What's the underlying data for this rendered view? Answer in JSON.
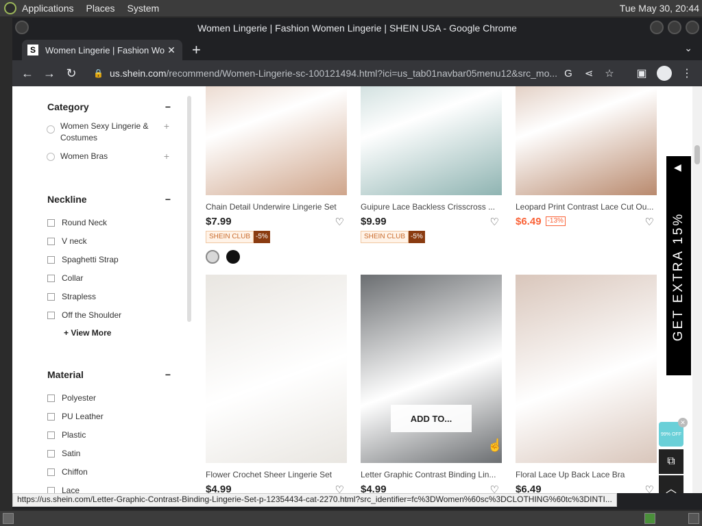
{
  "os": {
    "menus": [
      "Applications",
      "Places",
      "System"
    ],
    "clock": "Tue May 30, 20:44"
  },
  "browser": {
    "window_title": "Women Lingerie | Fashion Women Lingerie | SHEIN USA - Google Chrome",
    "tab": {
      "favicon": "S",
      "title": "Women Lingerie | Fashion Wo",
      "close": "✕"
    },
    "new_tab": "+",
    "url_host": "us.shein.com",
    "url_path": "/recommend/Women-Lingerie-sc-100121494.html?ici=us_tab01navbar05menu12&src_mo..."
  },
  "sidebar": {
    "groups": [
      {
        "title": "Category",
        "toggle": "−",
        "items": [
          {
            "label": "Women Sexy Lingerie & Costumes",
            "expand": "+"
          },
          {
            "label": "Women Bras",
            "expand": "+"
          }
        ]
      },
      {
        "title": "Neckline",
        "toggle": "−",
        "items": [
          "Round Neck",
          "V neck",
          "Spaghetti Strap",
          "Collar",
          "Strapless",
          "Off the Shoulder"
        ],
        "view_more": "+ View More"
      },
      {
        "title": "Material",
        "toggle": "−",
        "items": [
          "Polyester",
          "PU Leather",
          "Plastic",
          "Satin",
          "Chiffon",
          "Lace"
        ]
      }
    ]
  },
  "products": [
    {
      "name": "Chain Detail Underwire Lingerie Set",
      "price": "$7.99",
      "club": "SHEIN CLUB",
      "club_discount": "-5%",
      "swatch_colors": [
        "#d8d8d8",
        "#111111"
      ],
      "image_tone": "#cfa58b"
    },
    {
      "name": "Guipure Lace Backless Crisscross ...",
      "price": "$9.99",
      "club": "SHEIN CLUB",
      "club_discount": "-5%",
      "image_tone": "#8fb4b2"
    },
    {
      "name": "Leopard Print Contrast Lace Cut Ou...",
      "price": "$6.49",
      "discount": "-13%",
      "sale": true,
      "image_tone": "#b98a6e"
    },
    {
      "name": "Flower Crochet Sheer Lingerie Set",
      "price": "$4.99",
      "image_tone": "#e9e6e1"
    },
    {
      "name": "Letter Graphic Contrast Binding Lin...",
      "price": "$4.99",
      "image_tone": "#6b6e71",
      "hover_label": "ADD TO..."
    },
    {
      "name": "Floral Lace Up Back Lace Bra",
      "price": "$6.49",
      "image_tone": "#d9c6bb"
    }
  ],
  "promo": {
    "text": "GET EXTRA 15%",
    "arrow": "◀"
  },
  "widget": {
    "gift_text": "99% OFF",
    "close": "✕"
  },
  "side_buttons": {
    "compare": "⧉",
    "top": "︿"
  },
  "status_url": "https://us.shein.com/Letter-Graphic-Contrast-Binding-Lingerie-Set-p-12354434-cat-2270.html?src_identifier=fc%3DWomen%60sc%3DCLOTHING%60tc%3DINTI..."
}
